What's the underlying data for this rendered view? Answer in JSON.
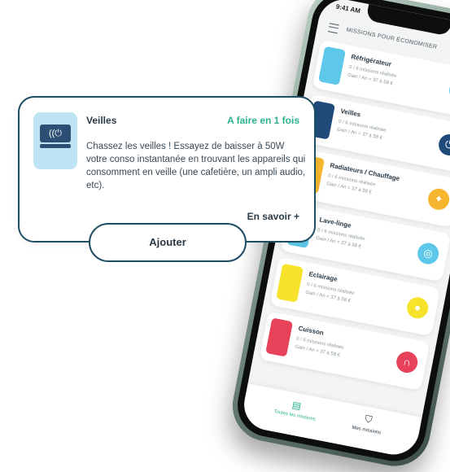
{
  "phone": {
    "status": {
      "time": "9:41 AM",
      "indicators": "▂▄▆ ▮"
    },
    "header": {
      "title": "MISSIONS POUR ÉCONOMISER",
      "menu_icon": "menu-icon"
    },
    "missions": [
      {
        "name": "Réfrigérateur",
        "progress": "0 / 6 missions réalisée",
        "gain": "Gain / An = 37 à 58 €",
        "color": "#5ec8ea",
        "icon": "❄"
      },
      {
        "name": "Veilles",
        "progress": "0 / 6 missions réalisée",
        "gain": "Gain / An = 37 à 58 €",
        "color": "#1f4a7a",
        "icon": "⏻"
      },
      {
        "name": "Radiateurs / Chauffage",
        "progress": "0 / 6 missions réalisée",
        "gain": "Gain / An = 37 à 58 €",
        "color": "#f6b52e",
        "icon": "✦"
      },
      {
        "name": "Lave-linge",
        "progress": "0 / 6 missions réalisée",
        "gain": "Gain / An = 37 à 58 €",
        "color": "#5ec8ea",
        "icon": "◎"
      },
      {
        "name": "Eclairage",
        "progress": "0 / 6 missions réalisée",
        "gain": "Gain / An = 37 à 58 €",
        "color": "#f7e22c",
        "icon": "●"
      },
      {
        "name": "Cuisson",
        "progress": "0 / 6 missions réalisée",
        "gain": "Gain / An = 37 à 58 €",
        "color": "#e8425a",
        "icon": "∩"
      }
    ],
    "tabs": [
      {
        "label": "Toutes les missions",
        "icon": "▤"
      },
      {
        "label": "Mes missions",
        "icon": "⛉"
      }
    ]
  },
  "popup": {
    "title": "Veilles",
    "frequency": "A faire en 1 fois",
    "description": "Chassez les veilles ! Essayez de  baisser à 50W votre conso instantanée en trouvant les appareils qui consomment en veille (une cafetière, un ampli audio, etc).",
    "more_link": "En savoir +",
    "thumb_icon": "((⏻",
    "add_button": "Ajouter"
  },
  "colors": {
    "primary": "#1f4d64",
    "accent": "#2bb28c",
    "text": "#2a3a46",
    "thumb_bg": "#bfe5f4"
  }
}
